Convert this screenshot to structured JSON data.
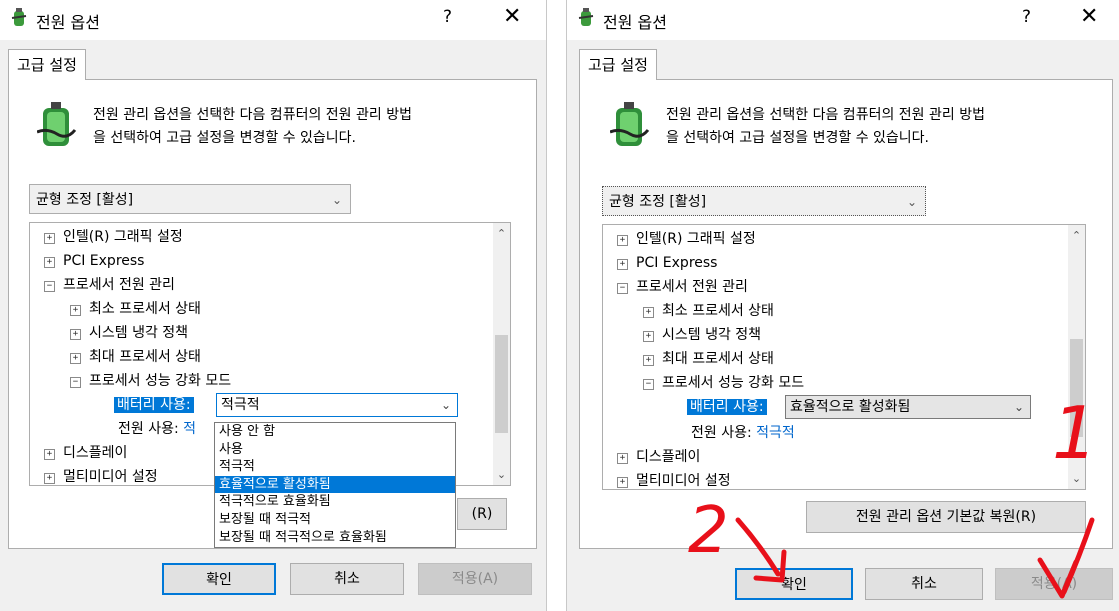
{
  "window_title": "전원 옵션",
  "help_label": "?",
  "close_label": "✕",
  "tab_label": "고급 설정",
  "description_line1": "전원 관리 옵션을 선택한 다음 컴퓨터의 전원 관리 방법",
  "description_line2": "을 선택하여 고급 설정을 변경할 수 있습니다.",
  "plan_selected": "균형 조정 [활성]",
  "tree": {
    "intel_graphics": "인텔(R) 그래픽 설정",
    "pci_express": "PCI Express",
    "processor_power": "프로세서 전원 관리",
    "min_processor": "최소 프로세서 상태",
    "cooling_policy": "시스템 냉각 정책",
    "max_processor": "최대 프로세서 상태",
    "boost_mode": "프로세서 성능 강화 모드",
    "on_battery_label": "배터리 사용:",
    "plugged_in_label": "전원 사용:",
    "display": "디스플레이",
    "multimedia": "멀티미디어 설정",
    "expand_glyph": "+",
    "collapse_glyph": "−"
  },
  "left": {
    "battery_value": "적극적",
    "plugged_in_value_partial": "적",
    "dropdown_options": [
      "사용 안 함",
      "사용",
      "적극적",
      "효율적으로 활성화됨",
      "적극적으로 효율화됨",
      "보장될 때 적극적",
      "보장될 때 적극적으로 효율화됨"
    ],
    "dropdown_highlighted_index": 3,
    "restore_partial": "(R)"
  },
  "right": {
    "battery_value": "효율적으로 활성화됨",
    "plugged_in_value": "적극적",
    "restore_label": "전원 관리 옵션 기본값 복원(R)"
  },
  "buttons": {
    "ok": "확인",
    "cancel": "취소",
    "apply": "적용(A)"
  },
  "annotations": {
    "one": "1",
    "two": "2"
  },
  "colors": {
    "selection": "#0078d7",
    "link_value": "#0066cc",
    "annotation_red": "#e8101a",
    "window_bg": "#f0f0f0"
  }
}
